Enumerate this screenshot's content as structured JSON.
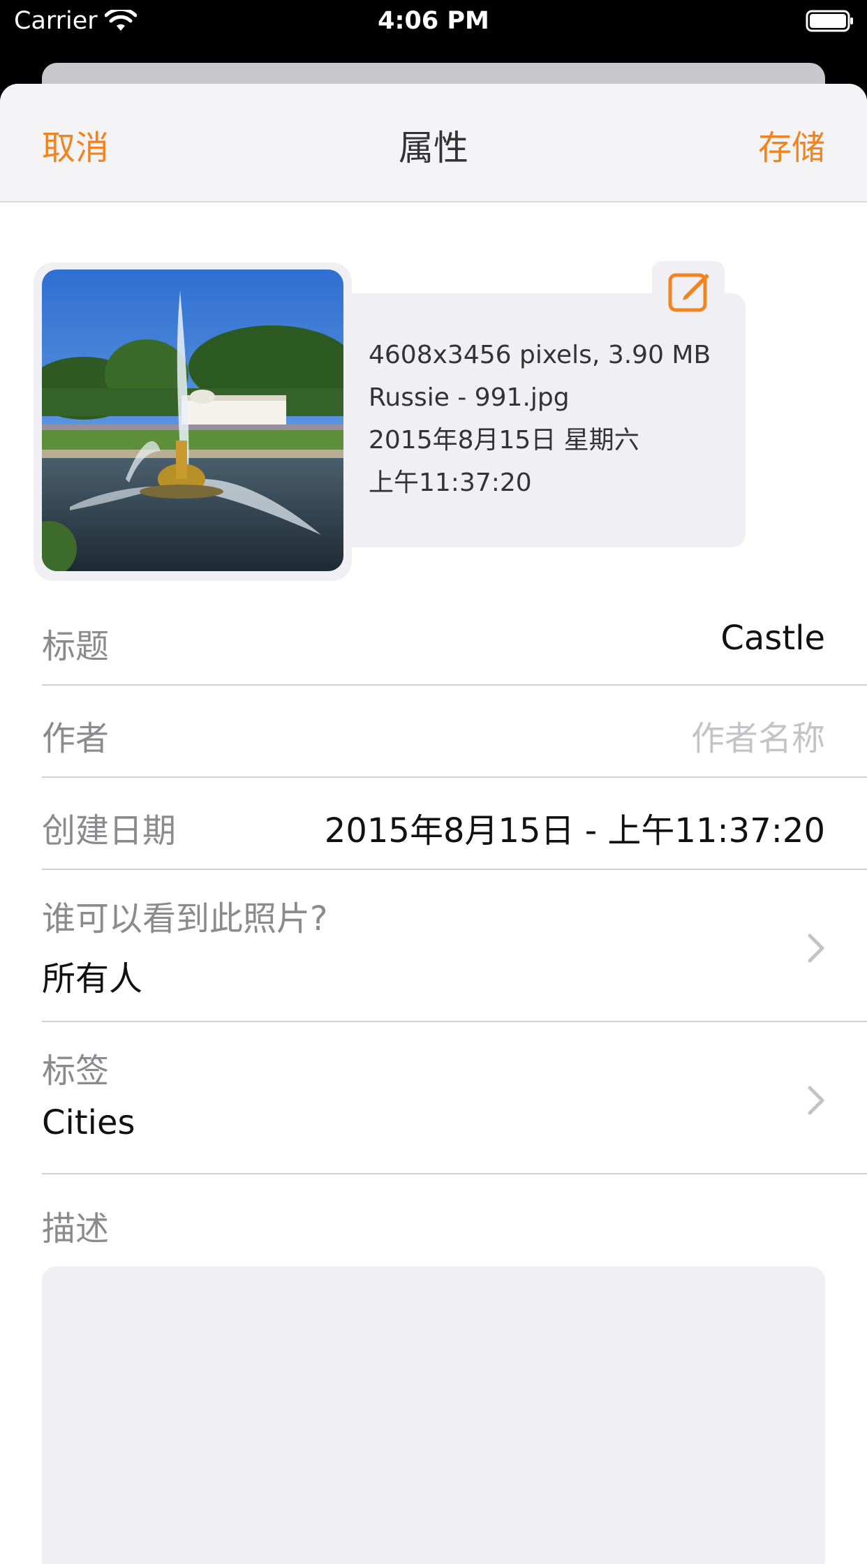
{
  "status_bar": {
    "carrier": "Carrier",
    "time": "4:06 PM"
  },
  "navbar": {
    "cancel": "取消",
    "title": "属性",
    "save": "存储"
  },
  "photo": {
    "dimensions_size": "4608x3456 pixels, 3.90 MB",
    "filename": "Russie - 991.jpg",
    "date": "2015年8月15日 星期六",
    "time": "上午11:37:20"
  },
  "form": {
    "title": {
      "label": "标题",
      "value": "Castle"
    },
    "author": {
      "label": "作者",
      "placeholder": "作者名称"
    },
    "created": {
      "label": "创建日期",
      "value": "2015年8月15日 - 上午11:37:20"
    },
    "visibility": {
      "label": "谁可以看到此照片?",
      "value": "所有人"
    },
    "tags": {
      "label": "标签",
      "value": "Cities"
    },
    "description": {
      "label": "描述"
    }
  },
  "colors": {
    "accent": "#f28420",
    "panel": "#efeff4"
  },
  "icons": [
    "wifi-icon",
    "battery-icon",
    "edit-icon",
    "chevron-right-icon"
  ]
}
